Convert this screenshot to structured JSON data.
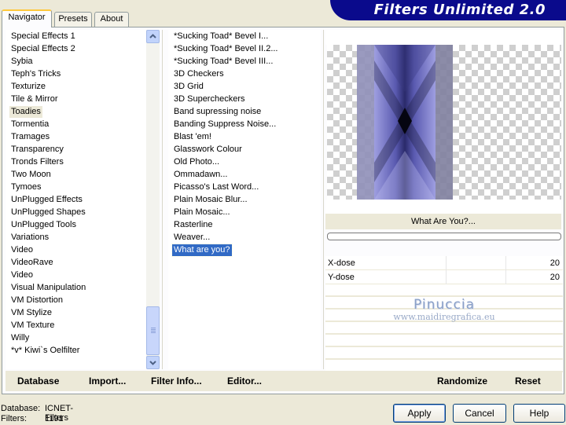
{
  "tabs": [
    {
      "label": "Navigator",
      "active": true
    },
    {
      "label": "Presets",
      "active": false
    },
    {
      "label": "About",
      "active": false
    }
  ],
  "app_title": "Filters Unlimited 2.0",
  "categories": [
    "Special Effects 1",
    "Special Effects 2",
    "Sybia",
    "Teph's Tricks",
    "Texturize",
    "Tile & Mirror",
    "Toadies",
    "Tormentia",
    "Tramages",
    "Transparency",
    "Tronds Filters",
    "Two Moon",
    "Tymoes",
    "UnPlugged Effects",
    "UnPlugged Shapes",
    "UnPlugged Tools",
    "Variations",
    "Video",
    "VideoRave",
    "Video",
    "Visual Manipulation",
    "VM Distortion",
    "VM Stylize",
    "VM Texture",
    "Willy",
    "*v* Kiwi`s Oelfilter"
  ],
  "selected_category": "Toadies",
  "filters": [
    "*Sucking Toad*  Bevel I...",
    "*Sucking Toad*  Bevel II.2...",
    "*Sucking Toad*  Bevel III...",
    "3D Checkers",
    "3D Grid",
    "3D Supercheckers",
    "Band supressing noise",
    "Banding Suppress Noise...",
    "Blast 'em!",
    "Glasswork Colour",
    "Old Photo...",
    "Ommadawn...",
    "Picasso's Last Word...",
    "Plain Mosaic Blur...",
    "Plain Mosaic...",
    "Rasterline",
    "Weaver...",
    "What are you?"
  ],
  "selected_filter": "What are you?",
  "filter_title": "What Are You?...",
  "params": [
    {
      "label": "X-dose",
      "value": "20"
    },
    {
      "label": "Y-dose",
      "value": "20"
    }
  ],
  "watermark": {
    "name": "Pinuccia",
    "url": "www.maidiregrafica.eu"
  },
  "links": {
    "database": "Database",
    "import": "Import...",
    "filter_info": "Filter Info...",
    "editor": "Editor...",
    "randomize": "Randomize",
    "reset": "Reset"
  },
  "status": {
    "database_label": "Database:",
    "database_value": "ICNET-Filters",
    "filters_label": "Filters:",
    "filters_value": "1191"
  },
  "buttons": {
    "apply": "Apply",
    "cancel": "Cancel",
    "help": "Help"
  },
  "colors": {
    "banner": "#0a0a8c",
    "selection": "#316ac5",
    "preview_main": "#5a5ab0",
    "preview_dark": "#1a1a3a"
  }
}
